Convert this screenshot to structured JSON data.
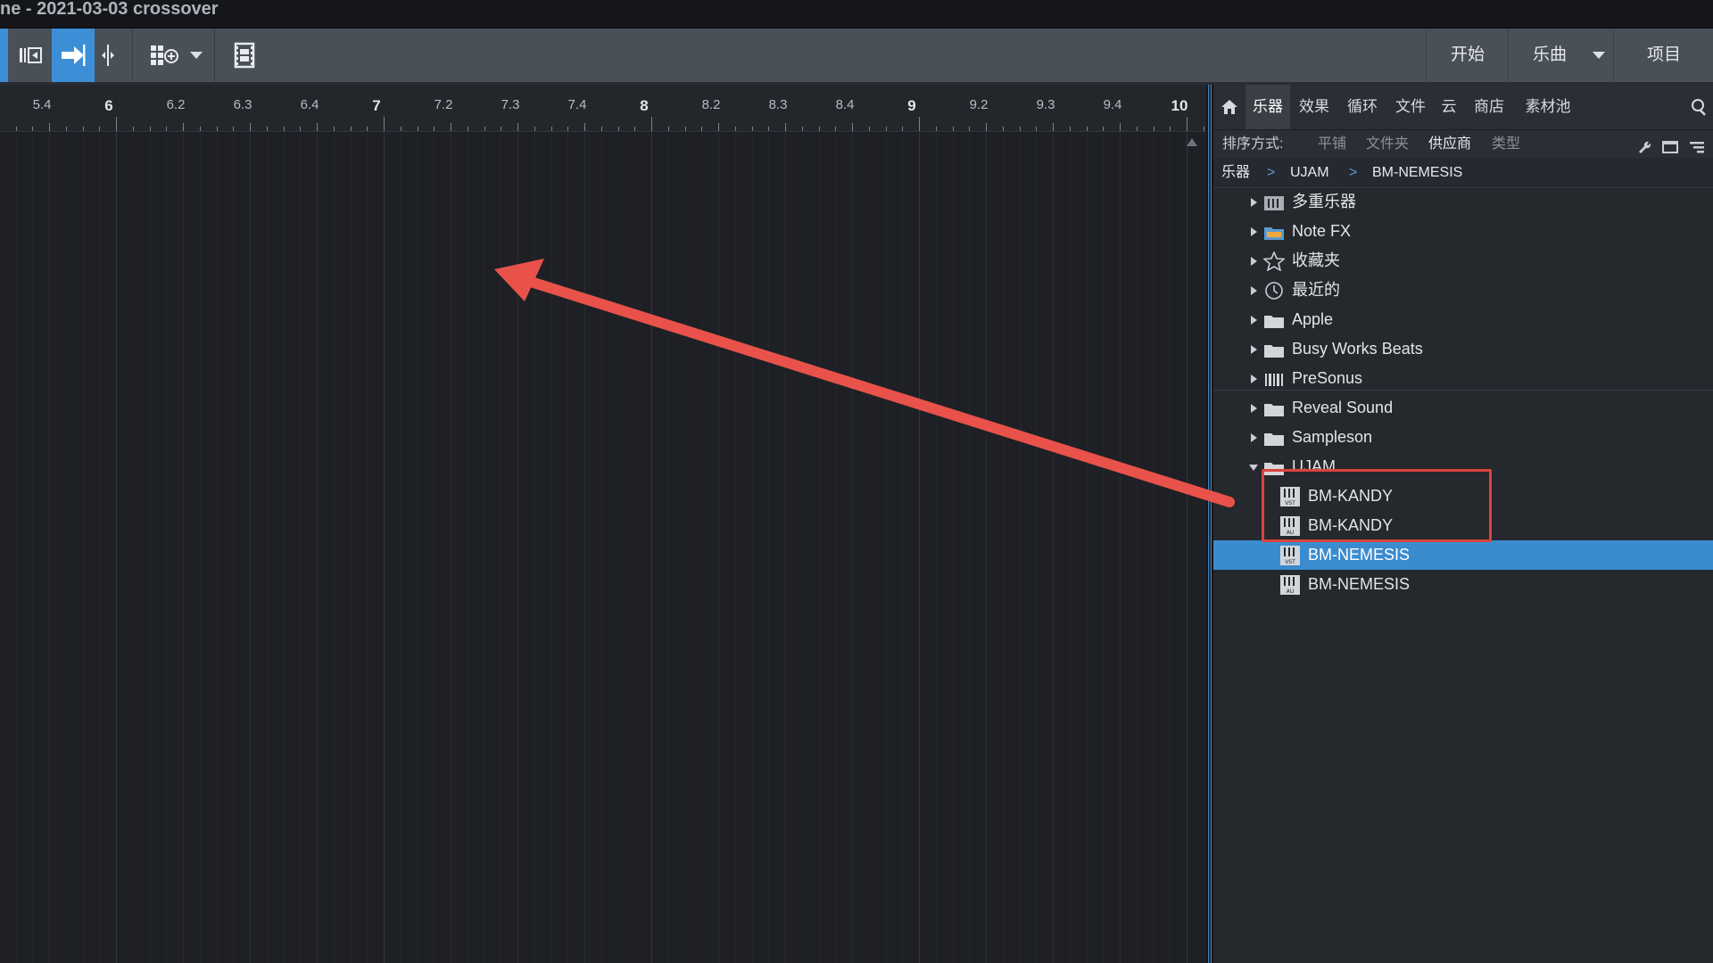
{
  "window": {
    "title": "ne - 2021-03-03 crossover"
  },
  "toolbar": {
    "right_buttons": {
      "start": "开始",
      "song": "乐曲",
      "project": "项目"
    }
  },
  "ruler": {
    "labels": [
      "5.4",
      "6",
      "6.2",
      "6.3",
      "6.4",
      "7",
      "7.2",
      "7.3",
      "7.4",
      "8",
      "8.2",
      "8.3",
      "8.4",
      "9",
      "9.2",
      "9.3",
      "9.4",
      "10"
    ]
  },
  "browser": {
    "tabs": [
      "乐器",
      "效果",
      "循环",
      "文件",
      "云",
      "商店",
      "素材池"
    ],
    "active_tab": "乐器",
    "sort": {
      "label": "排序方式:",
      "options": [
        "平铺",
        "文件夹",
        "供应商",
        "类型"
      ],
      "active": "供应商"
    },
    "breadcrumb": [
      "乐器",
      ">",
      "UJAM",
      ">",
      "BM-NEMESIS"
    ],
    "items": [
      {
        "label": "多重乐器",
        "icon": "multi-instrument-icon"
      },
      {
        "label": "Note FX",
        "icon": "note-fx-folder-icon"
      },
      {
        "label": "收藏夹",
        "icon": "star-icon"
      },
      {
        "label": "最近的",
        "icon": "clock-icon"
      },
      {
        "label": "Apple",
        "icon": "folder-icon"
      },
      {
        "label": "Busy Works Beats",
        "icon": "folder-icon"
      },
      {
        "label": "PreSonus",
        "icon": "presonus-icon"
      },
      {
        "label": "Reveal Sound",
        "icon": "folder-icon"
      },
      {
        "label": "Sampleson",
        "icon": "folder-icon"
      },
      {
        "label": "UJAM",
        "icon": "folder-icon",
        "expanded": true
      },
      {
        "label": "BM-KANDY",
        "icon": "vst-plugin-icon",
        "badge": "VST"
      },
      {
        "label": "BM-KANDY",
        "icon": "au-plugin-icon",
        "badge": "AU"
      },
      {
        "label": "BM-NEMESIS",
        "icon": "vst-plugin-icon",
        "badge": "VST",
        "selected": true
      },
      {
        "label": "BM-NEMESIS",
        "icon": "au-plugin-icon",
        "badge": "AU"
      }
    ]
  },
  "colors": {
    "accent": "#3b8ccf",
    "annotation": "#e8524a"
  }
}
